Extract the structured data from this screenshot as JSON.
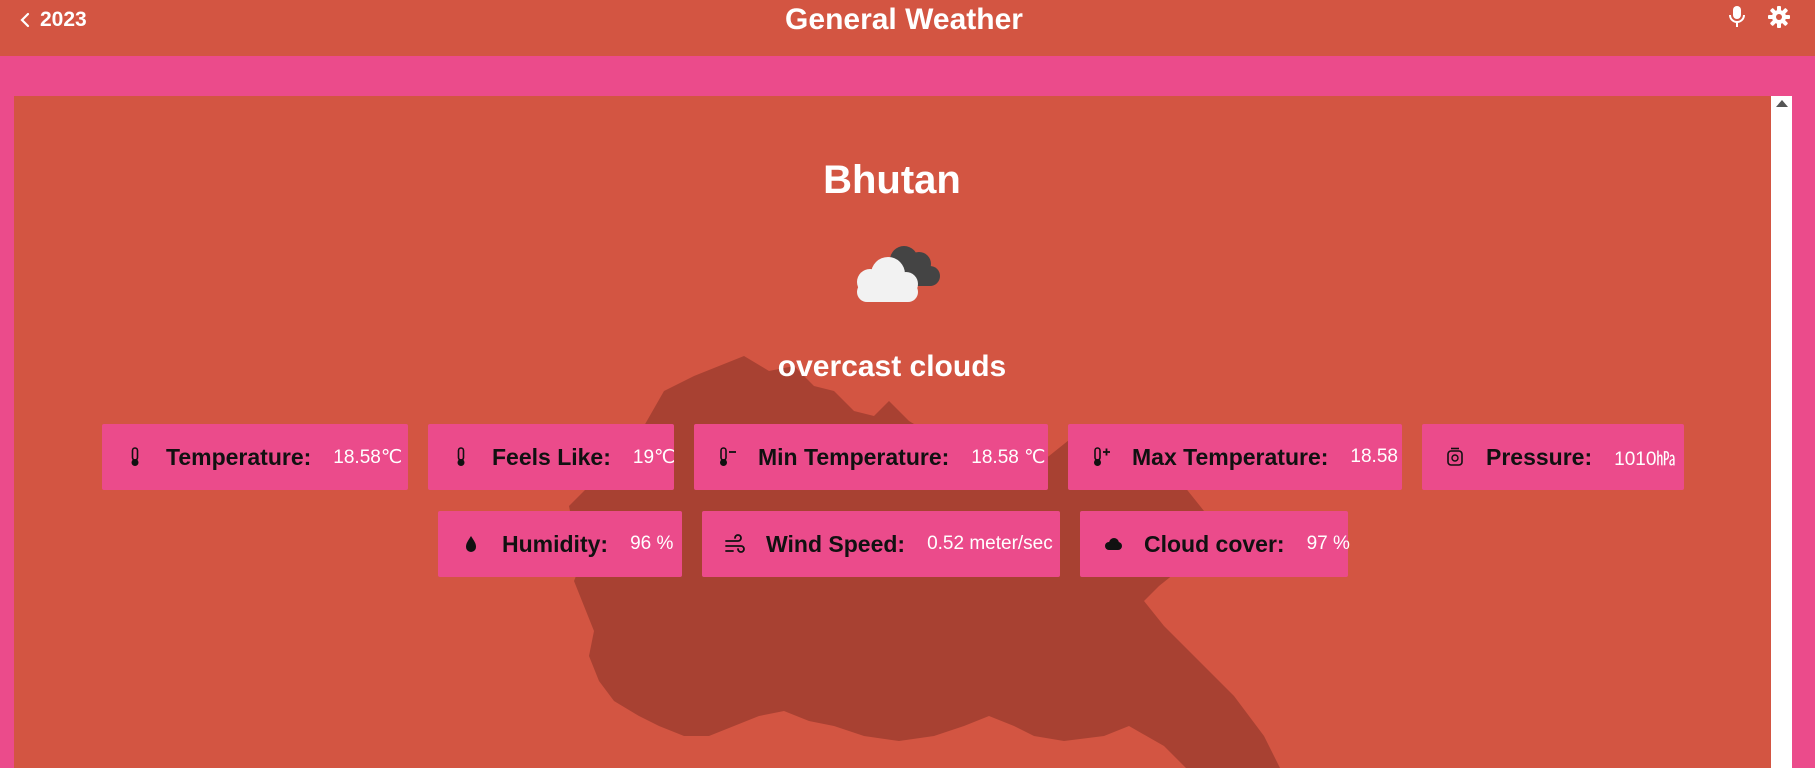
{
  "header": {
    "back_label": "2023",
    "title": "General Weather"
  },
  "weather": {
    "country": "Bhutan",
    "description": "overcast clouds",
    "icon": "overcast-clouds-icon"
  },
  "stats": [
    {
      "label": "Temperature:",
      "value": "18.58℃",
      "icon": "thermometer-icon"
    },
    {
      "label": "Feels Like:",
      "value": "19℃",
      "icon": "thermometer-icon"
    },
    {
      "label": "Min Temperature:",
      "value": "18.58 ℃",
      "icon": "thermometer-minus-icon"
    },
    {
      "label": "Max Temperature:",
      "value": "18.58",
      "icon": "thermometer-plus-icon"
    },
    {
      "label": "Pressure:",
      "value": "1010㍱",
      "icon": "barometer-icon"
    },
    {
      "label": "Humidity:",
      "value": "96 %",
      "icon": "water-drop-icon"
    },
    {
      "label": "Wind Speed:",
      "value": "0.52 meter/sec",
      "icon": "wind-icon"
    },
    {
      "label": "Cloud cover:",
      "value": "97 %",
      "icon": "cloud-icon"
    }
  ],
  "colors": {
    "background": "#d35542",
    "accent_pink": "#eb4b8b",
    "map_shape": "#a84132"
  }
}
